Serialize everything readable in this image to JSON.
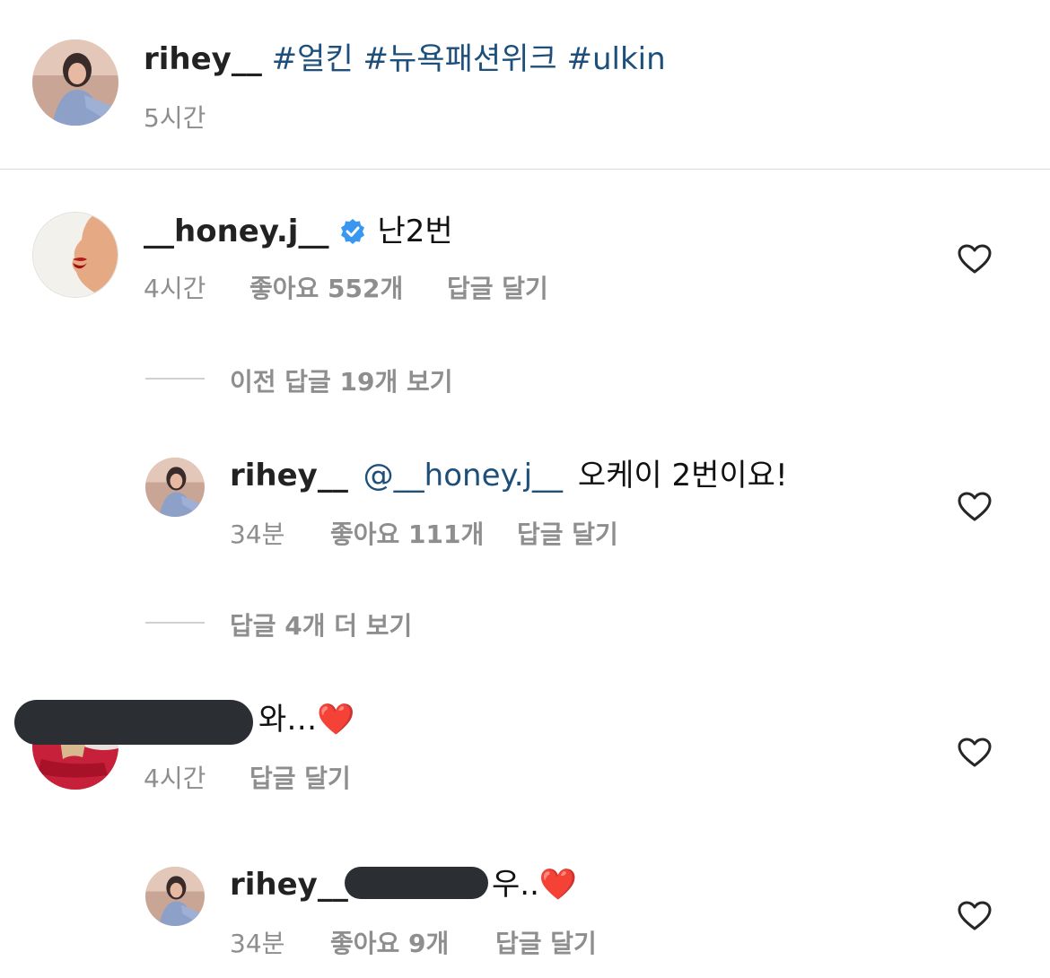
{
  "post": {
    "username": "rihey__",
    "hashtags": "#얼킨 #뉴욕패션위크 #ulkin",
    "time": "5시간"
  },
  "comments": [
    {
      "username": "__honey.j__",
      "verified": true,
      "text": "난2번",
      "time": "4시간",
      "likes": "좋아요 552개",
      "reply": "답글 달기"
    },
    {
      "view_previous": "이전 답글 19개 보기",
      "username": "rihey__",
      "mention": "@__honey.j__",
      "text": "오케이 2번이요!",
      "time": "34분",
      "likes": "좋아요 111개",
      "reply": "답글 달기"
    },
    {
      "view_more": "답글 4개 더 보기"
    },
    {
      "text": "와…❤️",
      "time": "4시간",
      "reply": "답글 달기"
    },
    {
      "username": "rihey__",
      "text": "우..❤️",
      "time": "34분",
      "likes": "좋아요 9개",
      "reply": "답글 달기"
    }
  ],
  "icons": {
    "heart": "heart-outline-icon",
    "verified": "verified-badge-icon"
  },
  "colors": {
    "link": "#1d4f7a",
    "meta": "#8e8e8e",
    "verified": "#3897f0"
  }
}
